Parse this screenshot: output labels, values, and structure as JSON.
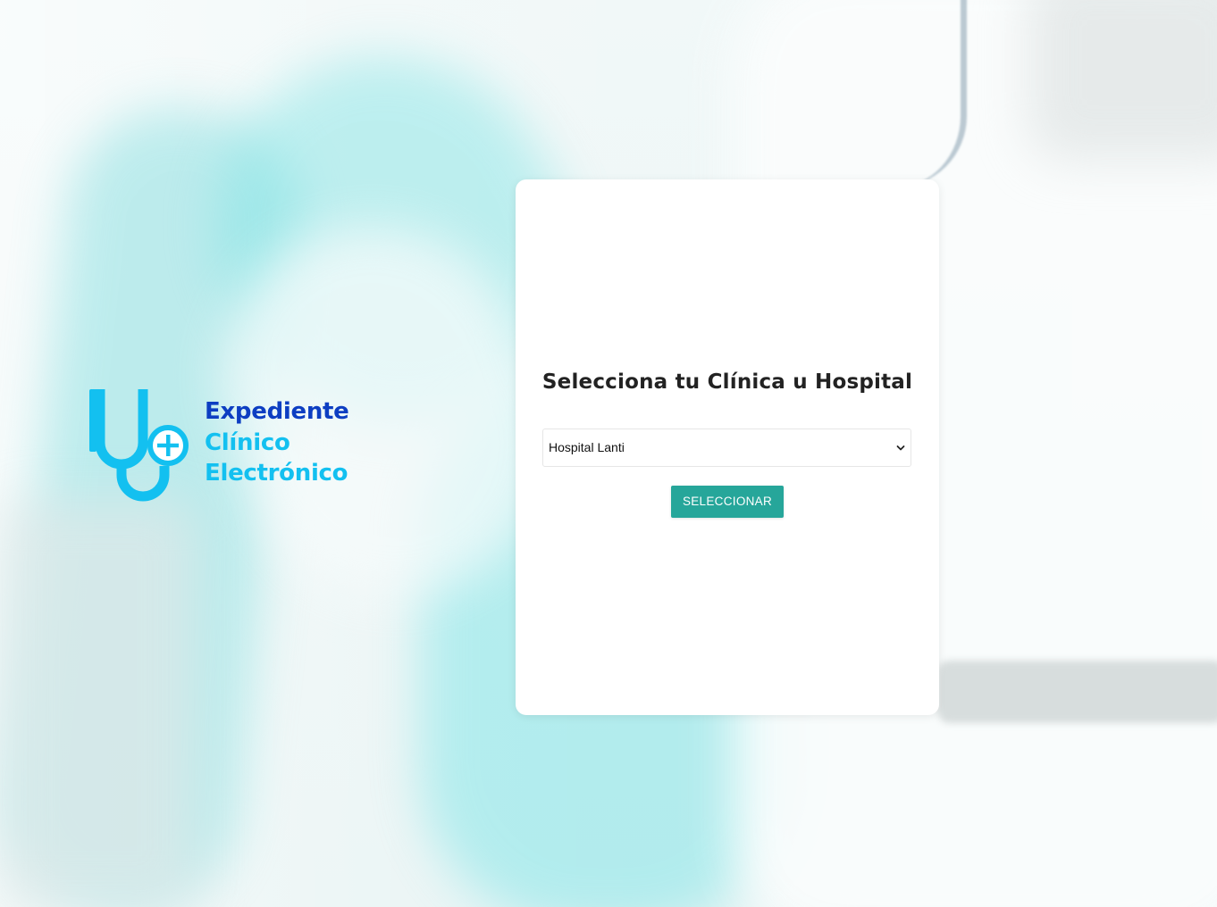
{
  "logo": {
    "line1": "Expediente",
    "line2": "Clínico",
    "line3": "Electrónico",
    "icon": "stethoscope-plus-icon",
    "colors": {
      "dark_blue": "#0d3ec2",
      "cyan": "#13c0f0"
    }
  },
  "card": {
    "title": "Selecciona tu Clínica u Hospital",
    "select": {
      "selected": "Hospital Lanti",
      "icon": "chevron-down-icon"
    },
    "button_label": "SELECCIONAR",
    "button_color": "#26a69a"
  }
}
